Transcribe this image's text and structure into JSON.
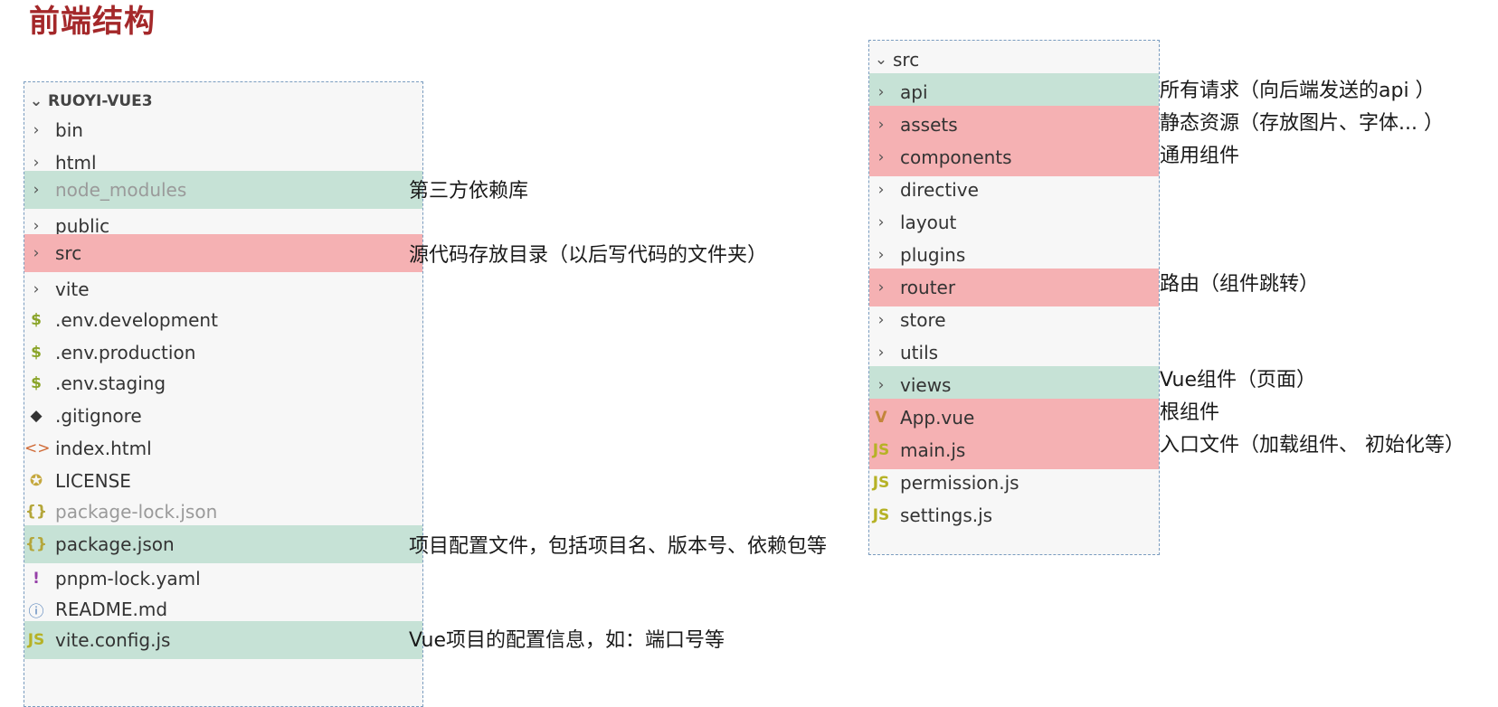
{
  "title": "前端结构",
  "left_tree": {
    "root": "RUOYI-VUE3",
    "items": [
      {
        "label": "bin",
        "icon": "chevron-right-icon",
        "hl": ""
      },
      {
        "label": "html",
        "icon": "chevron-right-icon",
        "hl": ""
      },
      {
        "label": "node_modules",
        "icon": "chevron-right-icon",
        "hl": "green"
      },
      {
        "label": "public",
        "icon": "chevron-right-icon",
        "hl": ""
      },
      {
        "label": "src",
        "icon": "chevron-right-icon",
        "hl": "red"
      },
      {
        "label": "vite",
        "icon": "chevron-right-icon",
        "hl": ""
      },
      {
        "label": ".env.development",
        "icon": "dollar-icon",
        "hl": ""
      },
      {
        "label": ".env.production",
        "icon": "dollar-icon",
        "hl": ""
      },
      {
        "label": ".env.staging",
        "icon": "dollar-icon",
        "hl": ""
      },
      {
        "label": ".gitignore",
        "icon": "git-icon",
        "hl": ""
      },
      {
        "label": "index.html",
        "icon": "html-icon",
        "hl": ""
      },
      {
        "label": "LICENSE",
        "icon": "license-icon",
        "hl": ""
      },
      {
        "label": "package-lock.json",
        "icon": "json-icon",
        "hl": ""
      },
      {
        "label": "package.json",
        "icon": "json-icon",
        "hl": "green"
      },
      {
        "label": "pnpm-lock.yaml",
        "icon": "yaml-icon",
        "hl": ""
      },
      {
        "label": "README.md",
        "icon": "info-icon",
        "hl": ""
      },
      {
        "label": "vite.config.js",
        "icon": "js-icon",
        "hl": "green"
      }
    ]
  },
  "left_notes": {
    "node_modules": "第三方依赖库",
    "src": "源代码存放目录（以后写代码的文件夹）",
    "package_json": "项目配置文件，包括项目名、版本号、依赖包等",
    "vite_config": "Vue项目的配置信息，如：端口号等"
  },
  "right_tree": {
    "root": "src",
    "items": [
      {
        "label": "api",
        "icon": "chevron-right-icon",
        "hl": "green"
      },
      {
        "label": "assets",
        "icon": "chevron-right-icon",
        "hl": "red"
      },
      {
        "label": "components",
        "icon": "chevron-right-icon",
        "hl": "red"
      },
      {
        "label": "directive",
        "icon": "chevron-right-icon",
        "hl": ""
      },
      {
        "label": "layout",
        "icon": "chevron-right-icon",
        "hl": ""
      },
      {
        "label": "plugins",
        "icon": "chevron-right-icon",
        "hl": ""
      },
      {
        "label": "router",
        "icon": "chevron-right-icon",
        "hl": "red"
      },
      {
        "label": "store",
        "icon": "chevron-right-icon",
        "hl": ""
      },
      {
        "label": "utils",
        "icon": "chevron-right-icon",
        "hl": ""
      },
      {
        "label": "views",
        "icon": "chevron-right-icon",
        "hl": "green"
      },
      {
        "label": "App.vue",
        "icon": "vue-icon",
        "hl": "red"
      },
      {
        "label": "main.js",
        "icon": "js-icon",
        "hl": "red"
      },
      {
        "label": "permission.js",
        "icon": "js-icon",
        "hl": ""
      },
      {
        "label": "settings.js",
        "icon": "js-icon",
        "hl": ""
      }
    ]
  },
  "right_notes": {
    "api": "所有请求（向后端发送的api ）",
    "assets": "静态资源（存放图片、字体... ）",
    "components": "通用组件",
    "router": "路由（组件跳转）",
    "views": "Vue组件（页面）",
    "app_vue": "根组件",
    "main_js": "入口文件（加载组件、 初始化等）"
  },
  "colors": {
    "title": "#a4282a",
    "green_highlight": "#c6e2d6",
    "red_highlight": "#f5b1b3"
  }
}
